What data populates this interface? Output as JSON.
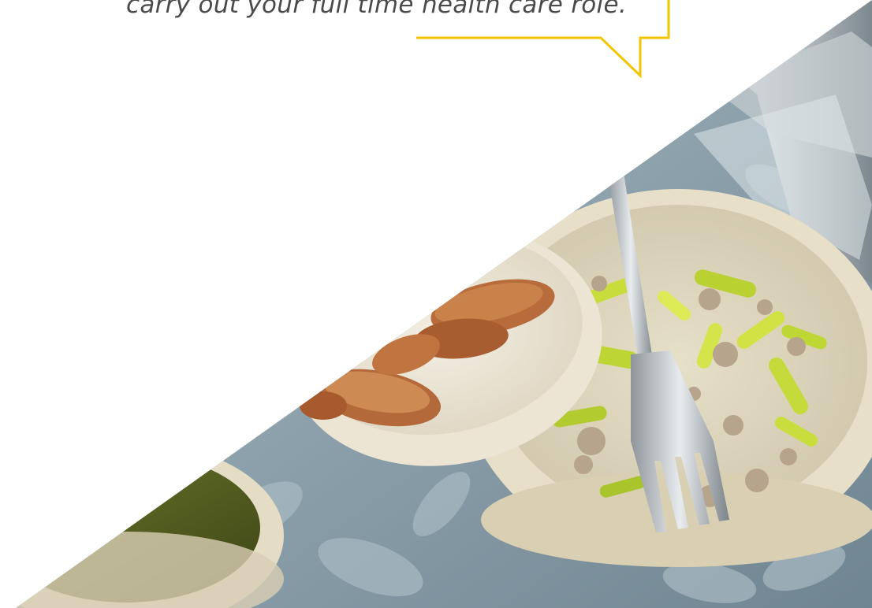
{
  "quote": {
    "text": "carry out your full time health care role."
  },
  "colors": {
    "accent_yellow": "#f2c500",
    "quote_text": "#4a4a4a",
    "tablecloth": "#8fa3ad",
    "bowl": "#e9e1cf",
    "peppers": "#b7d433",
    "sausage": "#b5683a"
  },
  "image": {
    "subject": "bowls of food with a fork"
  }
}
